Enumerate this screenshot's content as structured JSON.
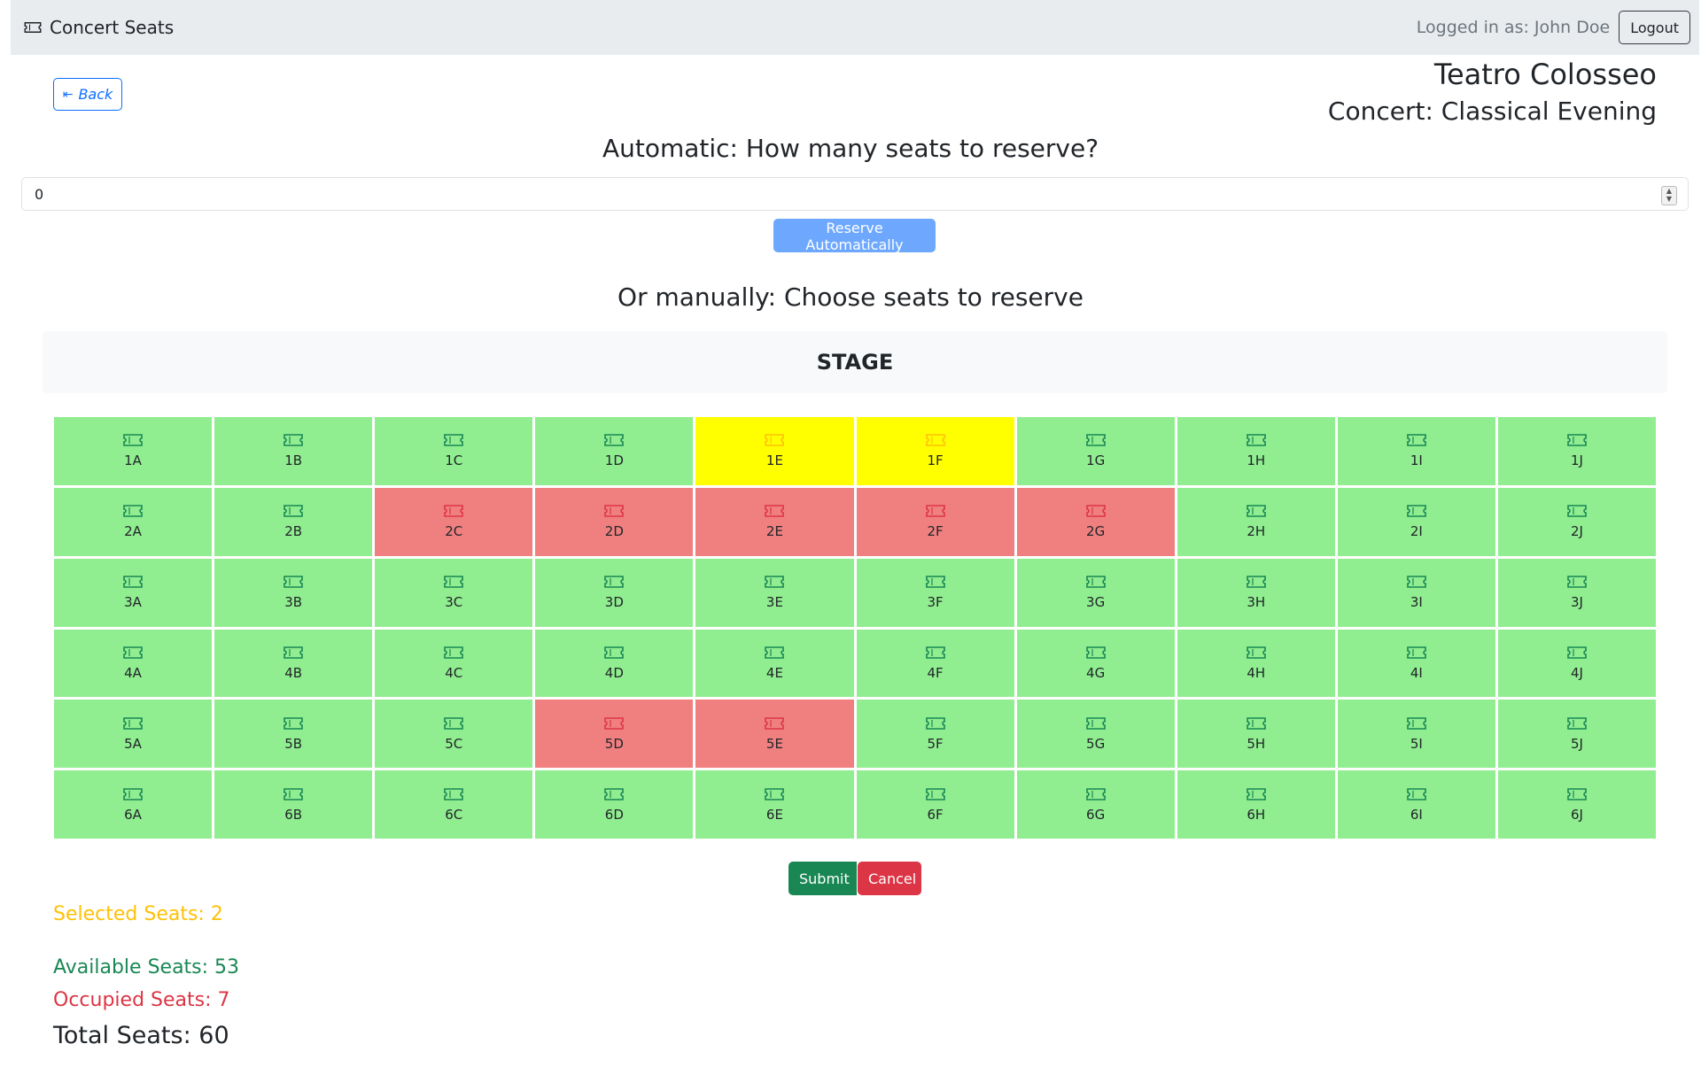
{
  "navbar": {
    "brand": "Concert Seats",
    "logged_in_text": "Logged in as: John Doe",
    "logout_label": "Logout"
  },
  "back_label": "Back",
  "venue": {
    "name": "Teatro Colosseo",
    "concert": "Concert: Classical Evening"
  },
  "auto": {
    "heading": "Automatic: How many seats to reserve?",
    "value": "0",
    "button_label": "Reserve Automatically"
  },
  "manual": {
    "heading": "Or manually: Choose seats to reserve",
    "stage_label": "STAGE"
  },
  "seat_rows": [
    {
      "row": "1",
      "seats": [
        {
          "label": "1A",
          "status": "available"
        },
        {
          "label": "1B",
          "status": "available"
        },
        {
          "label": "1C",
          "status": "available"
        },
        {
          "label": "1D",
          "status": "available"
        },
        {
          "label": "1E",
          "status": "selected"
        },
        {
          "label": "1F",
          "status": "selected"
        },
        {
          "label": "1G",
          "status": "available"
        },
        {
          "label": "1H",
          "status": "available"
        },
        {
          "label": "1I",
          "status": "available"
        },
        {
          "label": "1J",
          "status": "available"
        }
      ]
    },
    {
      "row": "2",
      "seats": [
        {
          "label": "2A",
          "status": "available"
        },
        {
          "label": "2B",
          "status": "available"
        },
        {
          "label": "2C",
          "status": "occupied"
        },
        {
          "label": "2D",
          "status": "occupied"
        },
        {
          "label": "2E",
          "status": "occupied"
        },
        {
          "label": "2F",
          "status": "occupied"
        },
        {
          "label": "2G",
          "status": "occupied"
        },
        {
          "label": "2H",
          "status": "available"
        },
        {
          "label": "2I",
          "status": "available"
        },
        {
          "label": "2J",
          "status": "available"
        }
      ]
    },
    {
      "row": "3",
      "seats": [
        {
          "label": "3A",
          "status": "available"
        },
        {
          "label": "3B",
          "status": "available"
        },
        {
          "label": "3C",
          "status": "available"
        },
        {
          "label": "3D",
          "status": "available"
        },
        {
          "label": "3E",
          "status": "available"
        },
        {
          "label": "3F",
          "status": "available"
        },
        {
          "label": "3G",
          "status": "available"
        },
        {
          "label": "3H",
          "status": "available"
        },
        {
          "label": "3I",
          "status": "available"
        },
        {
          "label": "3J",
          "status": "available"
        }
      ]
    },
    {
      "row": "4",
      "seats": [
        {
          "label": "4A",
          "status": "available"
        },
        {
          "label": "4B",
          "status": "available"
        },
        {
          "label": "4C",
          "status": "available"
        },
        {
          "label": "4D",
          "status": "available"
        },
        {
          "label": "4E",
          "status": "available"
        },
        {
          "label": "4F",
          "status": "available"
        },
        {
          "label": "4G",
          "status": "available"
        },
        {
          "label": "4H",
          "status": "available"
        },
        {
          "label": "4I",
          "status": "available"
        },
        {
          "label": "4J",
          "status": "available"
        }
      ]
    },
    {
      "row": "5",
      "seats": [
        {
          "label": "5A",
          "status": "available"
        },
        {
          "label": "5B",
          "status": "available"
        },
        {
          "label": "5C",
          "status": "available"
        },
        {
          "label": "5D",
          "status": "occupied"
        },
        {
          "label": "5E",
          "status": "occupied"
        },
        {
          "label": "5F",
          "status": "available"
        },
        {
          "label": "5G",
          "status": "available"
        },
        {
          "label": "5H",
          "status": "available"
        },
        {
          "label": "5I",
          "status": "available"
        },
        {
          "label": "5J",
          "status": "available"
        }
      ]
    },
    {
      "row": "6",
      "seats": [
        {
          "label": "6A",
          "status": "available"
        },
        {
          "label": "6B",
          "status": "available"
        },
        {
          "label": "6C",
          "status": "available"
        },
        {
          "label": "6D",
          "status": "available"
        },
        {
          "label": "6E",
          "status": "available"
        },
        {
          "label": "6F",
          "status": "available"
        },
        {
          "label": "6G",
          "status": "available"
        },
        {
          "label": "6H",
          "status": "available"
        },
        {
          "label": "6I",
          "status": "available"
        },
        {
          "label": "6J",
          "status": "available"
        }
      ]
    }
  ],
  "actions": {
    "submit_label": "Submit",
    "cancel_label": "Cancel"
  },
  "stats": {
    "selected": "Selected Seats: 2",
    "available": "Available Seats: 53",
    "occupied": "Occupied Seats: 7",
    "total": "Total Seats: 60"
  },
  "colors": {
    "available": "#90ee90",
    "selected": "#ffff00",
    "occupied": "#f08080",
    "primary": "#0d6efd",
    "success": "#198754",
    "danger": "#dc3545",
    "warning": "#ffc107"
  },
  "icons": {
    "brand": "ticket-icon",
    "seat": "ticket-icon",
    "back": "arrow-left-bar-icon"
  }
}
